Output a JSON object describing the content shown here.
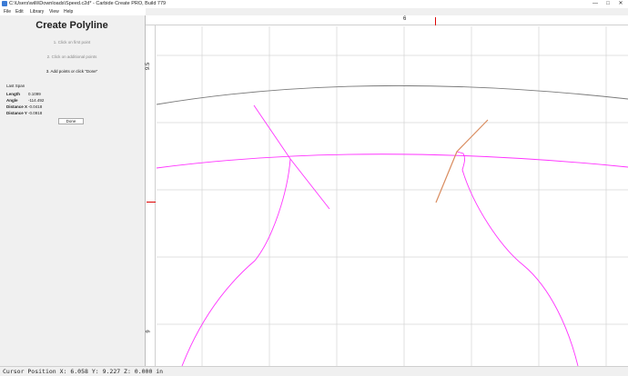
{
  "window": {
    "title": "C:\\Users\\willi\\Downloads\\Speed.c2d* - Carbide Create PRO, Build 779",
    "controls": [
      "—",
      "□",
      "✕"
    ]
  },
  "menu": [
    "File",
    "Edit",
    "Library",
    "View",
    "Help"
  ],
  "panel": {
    "title": "Create Polyline",
    "steps": [
      "1. Click on first point",
      "2. Click on additional points",
      "3. Add points or click \"Done\""
    ],
    "last_span": {
      "title": "Last Span",
      "rows": [
        {
          "label": "Length",
          "value": "0.1099"
        },
        {
          "label": "Angle",
          "value": "-114.492"
        },
        {
          "label": "Distance X",
          "value": "-0.0418"
        },
        {
          "label": "Distance Y",
          "value": "-0.0918"
        }
      ]
    },
    "done_label": "Done"
  },
  "canvas": {
    "top_ruler_label": "6",
    "left_ruler_labels": [
      "9.5",
      "9"
    ],
    "colors": {
      "grid": "#d6d6d6",
      "arc": "#7a7a7a",
      "polyline": "#ff33ff",
      "active_line": "#d98c5f",
      "ruler_marker": "#dd0000"
    }
  },
  "status": "Cursor Position X: 6.058 Y: 9.227 Z: 0.000 in"
}
